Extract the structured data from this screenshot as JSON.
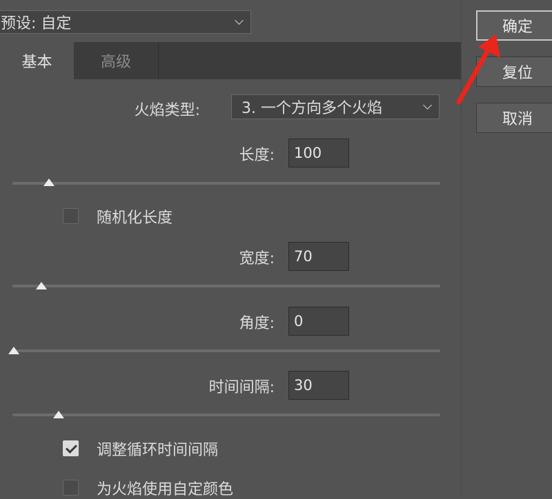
{
  "preset": {
    "label": "预设: 自定"
  },
  "tabs": [
    {
      "label": "基本",
      "active": true
    },
    {
      "label": "高级",
      "active": false
    }
  ],
  "buttons": {
    "ok": "确定",
    "reset": "复位",
    "cancel": "取消"
  },
  "flame_type": {
    "label": "火焰类型:",
    "value": "3. 一个方向多个火焰"
  },
  "length": {
    "label": "长度:",
    "value": "100",
    "slider_fraction": 0.085
  },
  "randomize_length": {
    "label": "随机化长度",
    "checked": false
  },
  "width": {
    "label": "宽度:",
    "value": "70",
    "slider_fraction": 0.068
  },
  "angle": {
    "label": "角度:",
    "value": "0",
    "slider_fraction": 0.0
  },
  "interval": {
    "label": "时间间隔:",
    "value": "30",
    "slider_fraction": 0.108
  },
  "adjust_loop": {
    "label": "调整循环时间间隔",
    "checked": true
  },
  "custom_color": {
    "label": "为火焰使用自定颜色",
    "checked": false
  },
  "colors": {
    "annotation_arrow": "#e8261b",
    "panel_bg": "#535353"
  }
}
